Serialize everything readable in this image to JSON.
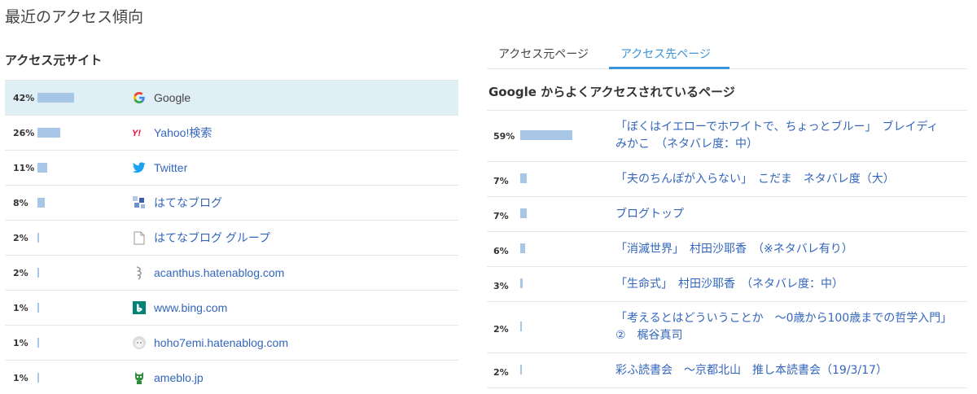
{
  "page": {
    "title": "最近のアクセス傾向"
  },
  "sources": {
    "heading": "アクセス元サイト",
    "items": [
      {
        "percent": "42%",
        "share": 42,
        "label": "Google",
        "icon": "google-icon"
      },
      {
        "percent": "26%",
        "share": 26,
        "label": "Yahoo!検索",
        "icon": "yahoo-icon"
      },
      {
        "percent": "11%",
        "share": 11,
        "label": "Twitter",
        "icon": "twitter-icon"
      },
      {
        "percent": "8%",
        "share": 8,
        "label": "はてなブログ",
        "icon": "hatena-blog-icon"
      },
      {
        "percent": "2%",
        "share": 2,
        "label": "はてなブログ グループ",
        "icon": "document-icon"
      },
      {
        "percent": "2%",
        "share": 2,
        "label": "acanthus.hatenablog.com",
        "icon": "acanthus-icon"
      },
      {
        "percent": "1%",
        "share": 1,
        "label": "www.bing.com",
        "icon": "bing-icon"
      },
      {
        "percent": "1%",
        "share": 1,
        "label": "hoho7emi.hatenablog.com",
        "icon": "hoho7emi-icon"
      },
      {
        "percent": "1%",
        "share": 1,
        "label": "ameblo.jp",
        "icon": "ameblo-icon"
      }
    ]
  },
  "tabs": [
    {
      "label": "アクセス元ページ",
      "active": false
    },
    {
      "label": "アクセス先ページ",
      "active": true
    }
  ],
  "destinations": {
    "heading": "Google からよくアクセスされているページ",
    "items": [
      {
        "percent": "59%",
        "share": 59,
        "title": "「ぼくはイエローでホワイトで、ちょっとブルー」　ブレイディみかこ　（ネタバレ度：中）"
      },
      {
        "percent": "7%",
        "share": 7,
        "title": "「夫のちんぽが入らない」　こだま　ネタバレ度（大）"
      },
      {
        "percent": "7%",
        "share": 7,
        "title": "ブログトップ"
      },
      {
        "percent": "6%",
        "share": 6,
        "title": "「消滅世界」　村田沙耶香　（※ネタバレ有り）"
      },
      {
        "percent": "3%",
        "share": 3,
        "title": "「生命式」　村田沙耶香　（ネタバレ度：中）"
      },
      {
        "percent": "2%",
        "share": 2,
        "title": "「考えるとはどういうことか　～0歳から100歳までの哲学入門」　②　梶谷真司"
      },
      {
        "percent": "2%",
        "share": 2,
        "title": "彩ふ読書会　～京都北山　推し本読書会（19/3/17）"
      }
    ]
  },
  "colors": {
    "bar": "#a8c6e6",
    "link": "#3366bb",
    "accent": "#3b94d9",
    "active_row": "#e0eff6"
  }
}
